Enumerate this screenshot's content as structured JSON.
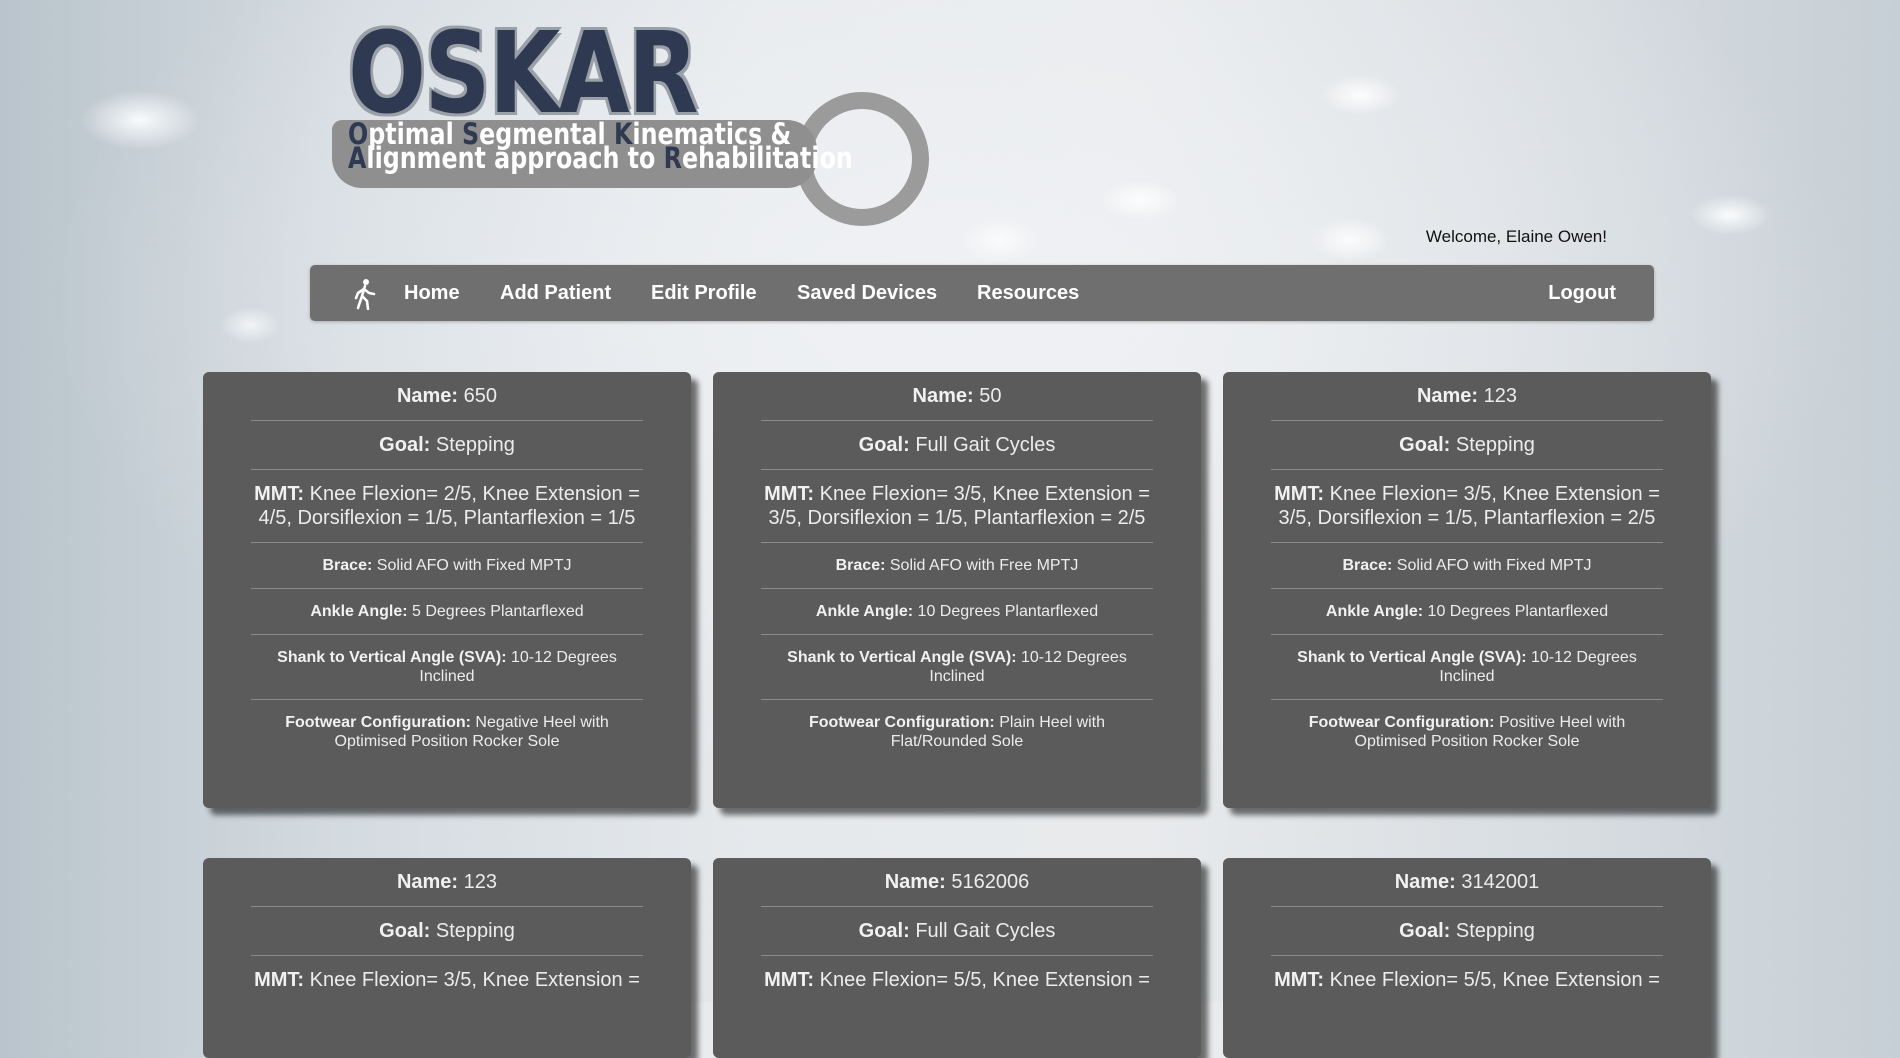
{
  "logo": {
    "title": "OSKAR",
    "subtitle_line1": [
      "O",
      "ptimal ",
      "S",
      "egmental ",
      "K",
      "inematics &"
    ],
    "subtitle_line2": [
      "A",
      "lignment approach to ",
      "R",
      "ehabilitation"
    ]
  },
  "welcome": "Welcome, Elaine Owen!",
  "nav": {
    "icon": "walking-person-icon",
    "items": [
      "Home",
      "Add Patient",
      "Edit Profile",
      "Saved Devices",
      "Resources"
    ],
    "logout": "Logout"
  },
  "labels": {
    "name": "Name:",
    "goal": "Goal:",
    "mmt": "MMT:",
    "brace": "Brace:",
    "ankle": "Ankle Angle:",
    "sva": "Shank to Vertical Angle (SVA):",
    "footwear": "Footwear Configuration:"
  },
  "patients": [
    {
      "name": "650",
      "goal": "Stepping",
      "mmt": "Knee Flexion= 2/5, Knee Extension = 4/5, Dorsiflexion = 1/5, Plantarflexion = 1/5",
      "brace": "Solid AFO with Fixed MPTJ",
      "ankle": "5 Degrees Plantarflexed",
      "sva": "10-12 Degrees Inclined",
      "footwear": "Negative Heel with Optimised Position Rocker Sole"
    },
    {
      "name": "50",
      "goal": "Full Gait Cycles",
      "mmt": "Knee Flexion= 3/5, Knee Extension = 3/5, Dorsiflexion = 1/5, Plantarflexion = 2/5",
      "brace": "Solid AFO with Free MPTJ",
      "ankle": "10 Degrees Plantarflexed",
      "sva": "10-12 Degrees Inclined",
      "footwear": "Plain Heel with Flat/Rounded Sole"
    },
    {
      "name": "123",
      "goal": "Stepping",
      "mmt": "Knee Flexion= 3/5, Knee Extension = 3/5, Dorsiflexion = 1/5, Plantarflexion = 2/5",
      "brace": "Solid AFO with Fixed MPTJ",
      "ankle": "10 Degrees Plantarflexed",
      "sva": "10-12 Degrees Inclined",
      "footwear": "Positive Heel with Optimised Position Rocker Sole"
    },
    {
      "name": "123",
      "goal": "Stepping",
      "mmt": "Knee Flexion= 3/5, Knee Extension ="
    },
    {
      "name": "5162006",
      "goal": "Full Gait Cycles",
      "mmt": "Knee Flexion= 5/5, Knee Extension ="
    },
    {
      "name": "3142001",
      "goal": "Stepping",
      "mmt": "Knee Flexion= 5/5, Knee Extension ="
    }
  ]
}
